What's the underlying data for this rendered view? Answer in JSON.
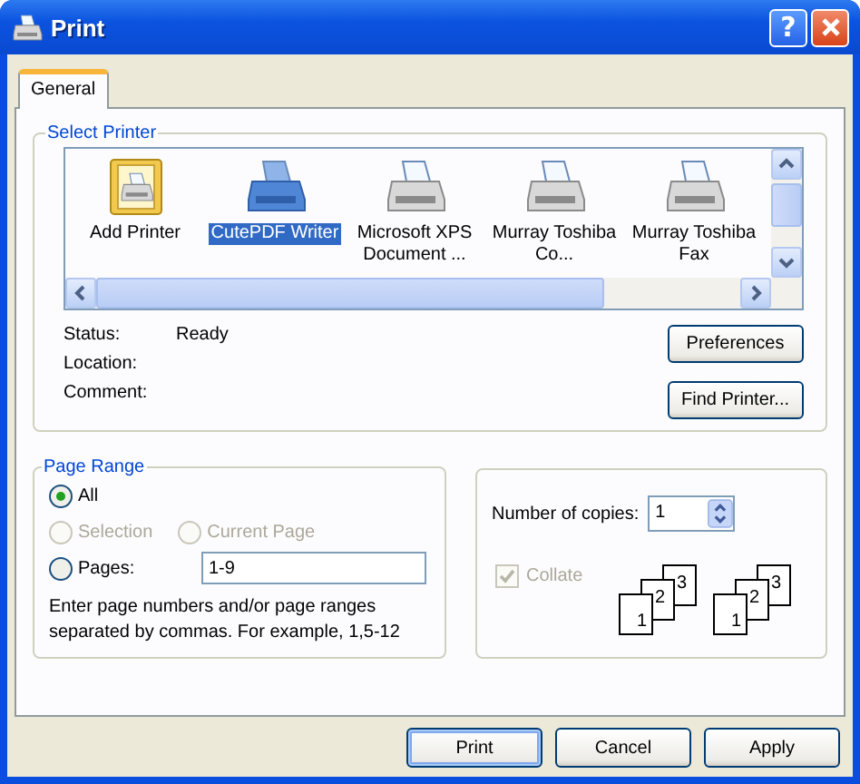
{
  "window": {
    "title": "Print",
    "help_button": "?"
  },
  "tabs": [
    {
      "label": "General",
      "selected": true
    }
  ],
  "select_printer": {
    "title": "Select Printer",
    "printers": [
      {
        "kind": "add",
        "label": "Add Printer",
        "selected": false
      },
      {
        "kind": "printer",
        "label": "CutePDF Writer",
        "selected": true
      },
      {
        "kind": "printer",
        "label": "Microsoft XPS Document ...",
        "selected": false
      },
      {
        "kind": "printer",
        "label": "Murray Toshiba Co...",
        "selected": false
      },
      {
        "kind": "printer",
        "label": "Murray Toshiba Fax",
        "selected": false
      }
    ],
    "info": [
      {
        "label": "Status:",
        "value": "Ready"
      },
      {
        "label": "Location:"
      },
      {
        "label": "Comment:"
      }
    ],
    "buttons": [
      "Preferences",
      "Find Printer..."
    ]
  },
  "page_range": {
    "title": "Page Range",
    "options": [
      {
        "label": "All",
        "selected": true,
        "disabled": false
      },
      {
        "label": "Selection",
        "selected": false,
        "disabled": true
      },
      {
        "label": "Current Page",
        "selected": false,
        "disabled": true
      },
      {
        "label": "Pages:",
        "selected": false,
        "disabled": false
      }
    ],
    "pages_value": "1-9",
    "hint": "Enter page numbers and/or page ranges separated by commas.  For example, 1,5-12"
  },
  "copies": {
    "label": "Number of copies:",
    "value": "1",
    "collate": {
      "label": "Collate",
      "checked": true,
      "disabled": true
    },
    "collate_diagrams": [
      {
        "pages": [
          "1",
          "2",
          "3"
        ]
      },
      {
        "pages": [
          "1",
          "2",
          "3"
        ]
      }
    ]
  },
  "buttons": [
    {
      "label": "Print",
      "default": true
    },
    {
      "label": "Cancel",
      "default": false
    },
    {
      "label": "Apply",
      "default": false
    }
  ]
}
